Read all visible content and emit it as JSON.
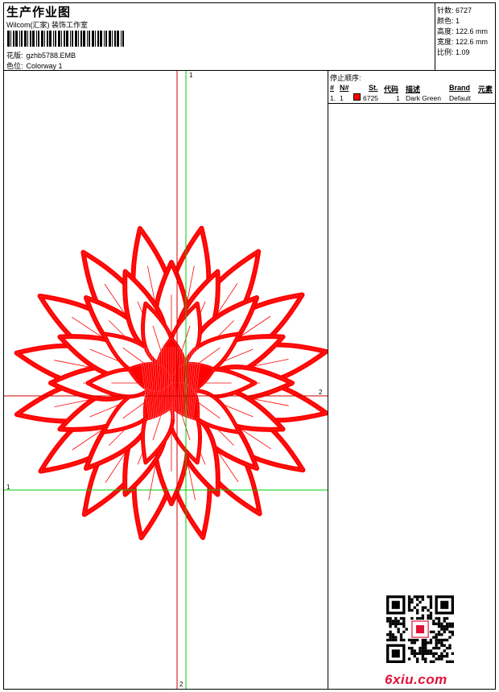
{
  "header": {
    "title": "生产作业图",
    "subtitle": "Wilcom(汇家) 装饰工作室",
    "design_label": "花版:",
    "design_value": "gzhb5788.EMB",
    "colorway_label": "色位:",
    "colorway_value": "Colorway 1"
  },
  "stats": [
    {
      "label": "针数:",
      "value": "6727"
    },
    {
      "label": "颜色:",
      "value": "1"
    },
    {
      "label": "高度:",
      "value": "122.6 mm"
    },
    {
      "label": "宽度:",
      "value": "122.6 mm"
    },
    {
      "label": "比例:",
      "value": "1.09"
    }
  ],
  "stop_sequence": {
    "title": "停止顺序:",
    "columns": [
      "#",
      "N#",
      "St.",
      "代码",
      "描述",
      "Brand",
      "元素"
    ],
    "rows": [
      {
        "index": "1.",
        "needle": "1",
        "code": "6725",
        "stitches": "1",
        "description": "Dark Green",
        "brand": "Default",
        "swatch_color": "#ff0000"
      }
    ]
  },
  "guides": {
    "v_green": "1",
    "h_red": "2",
    "h_green": "1",
    "v_red": "2"
  },
  "colors": {
    "thread": "#ff0000",
    "guide_green": "#00cc00",
    "guide_red": "#cc0000",
    "logo": "#e0123a"
  },
  "logo_text": "6xiu.com"
}
